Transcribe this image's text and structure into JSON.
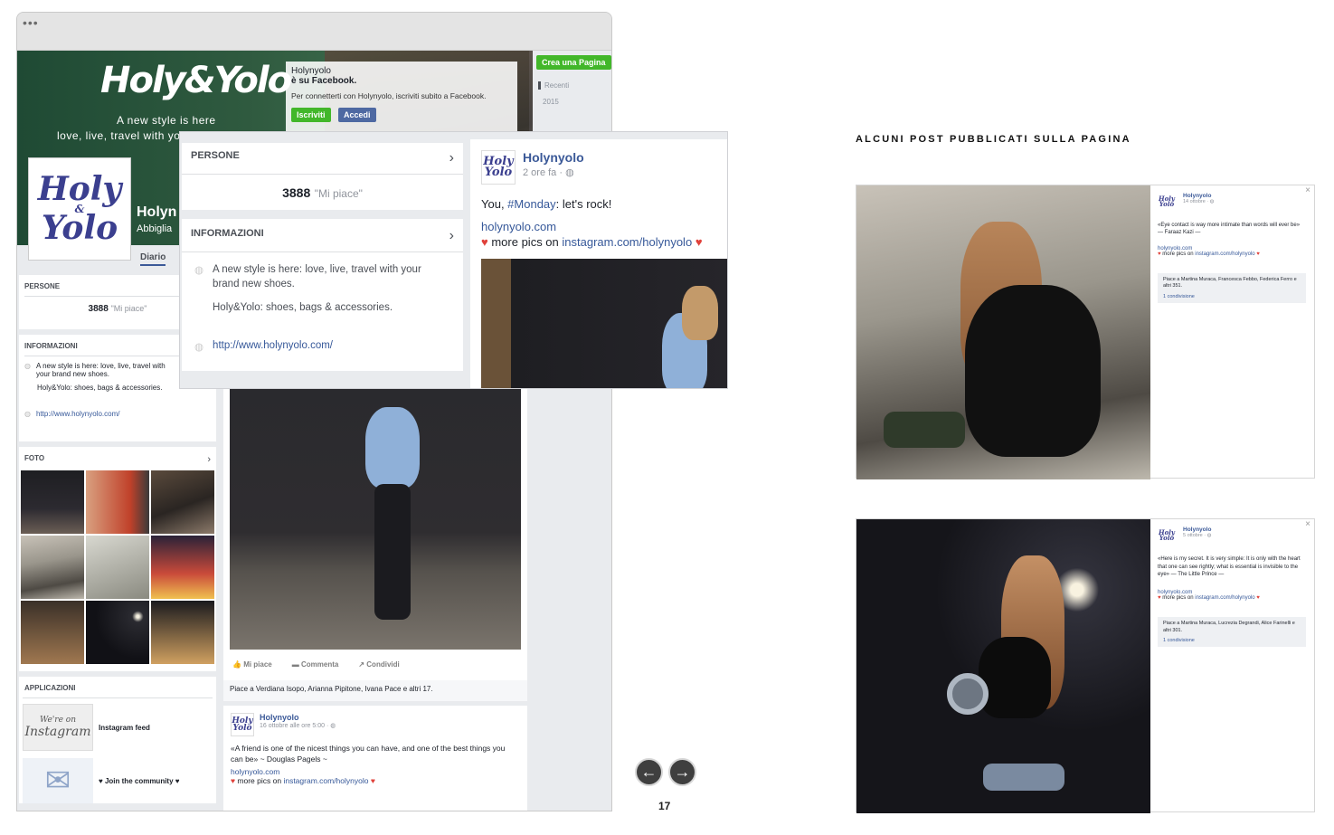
{
  "window": {
    "dots": "•••"
  },
  "cover": {
    "brand_logo": "Holy&Yolo",
    "tagline_line1": "A new style is here",
    "tagline_line2": "love, live, travel with you"
  },
  "profile": {
    "logo_top": "Holy",
    "logo_amp": "&",
    "logo_bottom": "Yolo",
    "name": "Holyn",
    "category": "Abbiglia",
    "tab_diario": "Diario"
  },
  "join_popup": {
    "name": "Holynyolo",
    "subtitle": "è su Facebook.",
    "text": "Per connetterti con Holynyolo, iscriviti subito a Facebook.",
    "signup": "Iscriviti",
    "login": "Accedi"
  },
  "right_column": {
    "create_page": "Crea una Pagina",
    "recent": "Recenti",
    "year": "2015"
  },
  "left_col": {
    "persone_title": "PERSONE",
    "likes_count": "3888",
    "likes_label": "\"Mi piace\"",
    "info_title": "INFORMAZIONI",
    "info_text": "A new style is here: love, live, travel with your brand new shoes.",
    "info_text2": "Holy&Yolo: shoes, bags & accessories.",
    "info_link": "http://www.holynyolo.com/",
    "foto_title": "FOTO",
    "apps_title": "APPLICAZIONI",
    "app1_thumb_line1": "We're on",
    "app1_thumb_line2": "Instagram",
    "app1_label": "Instagram feed",
    "app2_label": "♥ Join the community ♥"
  },
  "zoom_left": {
    "persone_title": "PERSONE",
    "likes_count": "3888",
    "likes_label": "\"Mi piace\"",
    "info_title": "INFORMAZIONI",
    "info_text": "A new style is here: love, live, travel with your brand new shoes.",
    "info_text2": "Holy&Yolo: shoes, bags & accessories.",
    "info_link": "http://www.holynyolo.com/"
  },
  "zoom_post": {
    "page_name": "Holynyolo",
    "time": "2 ore fa · ◍",
    "text_prefix": "You, ",
    "hashtag": "#Monday",
    "text_suffix": ": let's rock!",
    "link": "holynyolo.com",
    "more_prefix": "more pics on ",
    "more_link": "instagram.com/holynyolo"
  },
  "feed": {
    "actions": [
      "Mi piace",
      "Commenta",
      "Condividi"
    ],
    "likers": "Piace a Verdiana Isopo, Arianna Pipitone, Ivana Pace e altri 17.",
    "post2_name": "Holynyolo",
    "post2_time": "16 ottobre alle ore 5:00 · ◍",
    "post2_quote": "«A friend is one of the nicest things you can have, and one of the best things you can be» ~ Douglas Pagels ~",
    "post2_link": "holynyolo.com",
    "post2_more_prefix": "more pics on ",
    "post2_more_link": "instagram.com/holynyolo"
  },
  "nav": {
    "prev": "prev-arrow",
    "next": "next-arrow",
    "page_number": "17"
  },
  "section_heading": "ALCUNI POST PUBBLICATI SULLA PAGINA",
  "post_a": {
    "name": "Holynyolo",
    "date": "14 ottobre · ◍",
    "quote": "«Eye contact is way more intimate than words will ever be»",
    "author": "— Faraaz Kazi —",
    "link": "holynyolo.com",
    "more_prefix": "more pics on ",
    "more_link": "instagram.com/holynyolo",
    "likers": "Piace a Martina Muraca, Francesca Febbo, Federica Ferro e altri 351.",
    "shares": "1 condivisione",
    "close": "×"
  },
  "post_b": {
    "name": "Holynyolo",
    "date": "5 ottobre · ◍",
    "quote": "«Here is my secret. It is very simple: It is only with the heart that one can see rightly; what is essential is invisible to the eye» — The Little Prince —",
    "link": "holynyolo.com",
    "more_prefix": "more pics on ",
    "more_link": "instagram.com/holynyolo",
    "likers": "Piace a Martina Muraca, Lucrezia Degrandi, Alice Farinelli e altri 301.",
    "shares": "1 condivisione",
    "close": "×"
  },
  "colors": {
    "fb_blue": "#3b5998",
    "green": "#42b72a",
    "cover_green": "#2f5a3f"
  }
}
